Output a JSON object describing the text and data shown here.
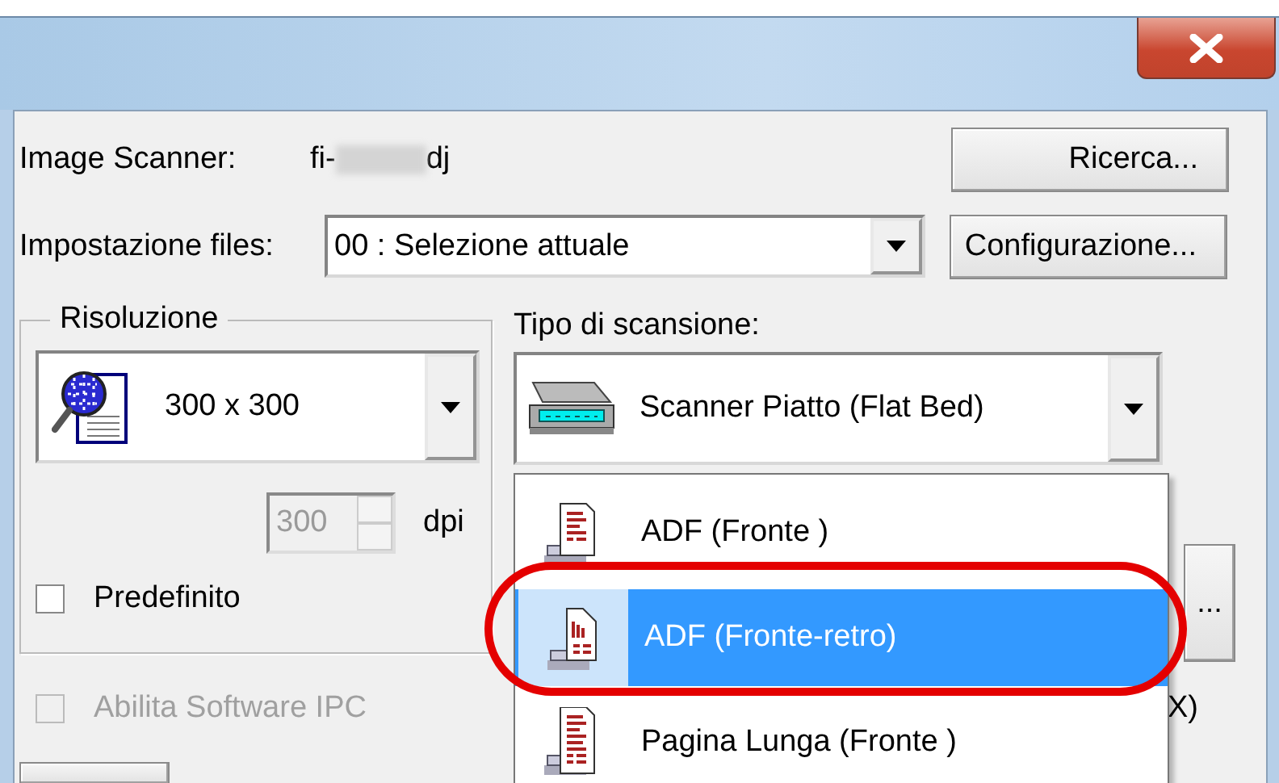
{
  "scanner": {
    "label": "Image Scanner:",
    "model_prefix": "fi-",
    "model_suffix": "dj",
    "button": "Ricerca..."
  },
  "file_settings": {
    "label": "Impostazione files:",
    "value": "00 : Selezione attuale",
    "button": "Configurazione..."
  },
  "resolution": {
    "title": "Risoluzione",
    "value": "300 x 300",
    "dpi_value": "300",
    "dpi_disabled": true,
    "dpi_unit": "dpi",
    "default_checkbox": {
      "label": "Predefinito",
      "checked": false
    }
  },
  "scan_type": {
    "label": "Tipo di scansione:",
    "value": "Scanner Piatto (Flat Bed)",
    "expanded": true,
    "options": [
      {
        "label": "ADF (Fronte )",
        "selected": false,
        "kind": "simplex"
      },
      {
        "label": "ADF (Fronte-retro)",
        "selected": true,
        "kind": "duplex"
      },
      {
        "label": "Pagina Lunga (Fronte )",
        "selected": false,
        "kind": "long"
      }
    ]
  },
  "ipc_checkbox": {
    "label": "Abilita Software IPC",
    "checked": false,
    "disabled": true
  },
  "side_button": "...",
  "side_text": "X)"
}
